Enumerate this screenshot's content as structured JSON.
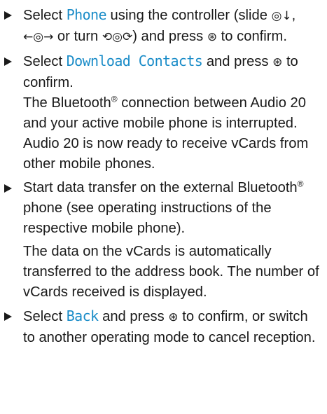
{
  "accent_color": "#1a8cc8",
  "text_color": "#1a1a1a",
  "steps": [
    {
      "parts": [
        "Select ",
        "Phone",
        " using the controller (slide ",
        "◎↓",
        ", ",
        "←◎→",
        " or turn ",
        "⟲◎⟳",
        ") and press ",
        "⊛",
        " to confirm."
      ]
    },
    {
      "parts": [
        "Select ",
        "Download Contacts",
        " and press ",
        "⊛",
        " to confirm."
      ],
      "result": [
        "The Bluetooth",
        "®",
        " connection between Audio 20 and your active mobile phone is interrupted. Audio 20 is now ready to receive vCards from other mobile phones."
      ]
    },
    {
      "parts": [
        "Start data transfer on the external Bluetooth",
        "®",
        " phone (see operating instructions of the respective mobile phone)."
      ],
      "result": [
        "The data on the vCards is automatically transferred to the address book. The number of vCards received is displayed."
      ]
    },
    {
      "parts": [
        "Select ",
        "Back",
        " and press ",
        "⊛",
        " to confirm, or switch to another operating mode to cancel reception."
      ]
    }
  ]
}
